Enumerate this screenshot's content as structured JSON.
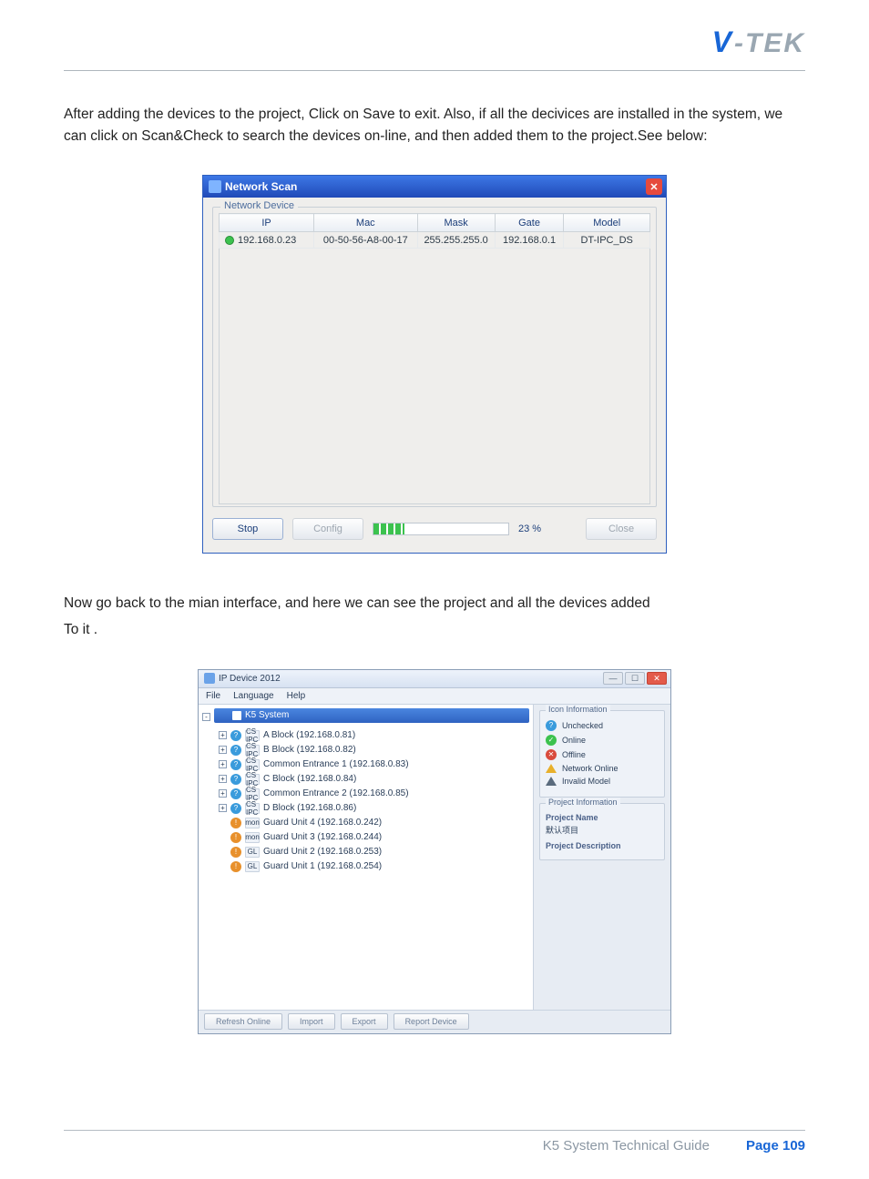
{
  "logo": {
    "v": "V",
    "rest": "-TEK"
  },
  "para1": "After adding the devices to the project, Click on Save to exit. Also, if all the decivices are installed in the system, we can click on Scan&Check to search the devices on-line, and then added them to the project.See below:",
  "para2a": "Now go back to the mian interface, and here we can see the project and all the devices added",
  "para2b": "To it .",
  "dlg1": {
    "title": "Network Scan",
    "fieldset": "Network Device",
    "cols": {
      "ip": "IP",
      "mac": "Mac",
      "mask": "Mask",
      "gate": "Gate",
      "model": "Model"
    },
    "row": {
      "ip": "192.168.0.23",
      "mac": "00-50-56-A8-00-17",
      "mask": "255.255.255.0",
      "gate": "192.168.0.1",
      "model": "DT-IPC_DS"
    },
    "stop": "Stop",
    "config": "Config",
    "progress": "23 %",
    "close": "Close"
  },
  "dlg2": {
    "title": "IP Device 2012",
    "menu": {
      "file": "File",
      "lang": "Language",
      "help": "Help"
    },
    "root": "K5 System",
    "items": [
      {
        "exp": "+",
        "status": "blue",
        "type": "CS IPC",
        "label": "A Block (192.168.0.81)"
      },
      {
        "exp": "+",
        "status": "blue",
        "type": "CS IPC",
        "label": "B Block (192.168.0.82)"
      },
      {
        "exp": "+",
        "status": "blue",
        "type": "CS IPC",
        "label": "Common Entrance 1 (192.168.0.83)"
      },
      {
        "exp": "+",
        "status": "blue",
        "type": "CS IPC",
        "label": "C Block (192.168.0.84)"
      },
      {
        "exp": "+",
        "status": "blue",
        "type": "CS IPC",
        "label": "Common Entrance 2 (192.168.0.85)"
      },
      {
        "exp": "+",
        "status": "blue",
        "type": "CS IPC",
        "label": "D Block (192.168.0.86)"
      },
      {
        "exp": "",
        "status": "orange",
        "type": "mon",
        "label": "Guard Unit 4 (192.168.0.242)"
      },
      {
        "exp": "",
        "status": "orange",
        "type": "mon",
        "label": "Guard Unit 3 (192.168.0.244)"
      },
      {
        "exp": "",
        "status": "orange",
        "type": "GL",
        "label": "Guard Unit 2 (192.168.0.253)"
      },
      {
        "exp": "",
        "status": "orange",
        "type": "GL",
        "label": "Guard Unit 1 (192.168.0.254)"
      }
    ],
    "iconLegend": {
      "title": "Icon Information",
      "unchecked": "Unchecked",
      "online": "Online",
      "offline": "Offline",
      "netonline": "Network Online",
      "invalid": "Invalid Model"
    },
    "projInfo": {
      "title": "Project Information",
      "nameLbl": "Project Name",
      "nameVal": "默认项目",
      "descLbl": "Project Description"
    },
    "bottom": {
      "refresh": "Refresh Online",
      "import": "Import",
      "export": "Export",
      "report": "Report Device"
    }
  },
  "footer": {
    "guide": "K5 System Technical Guide",
    "page": "Page 109"
  }
}
